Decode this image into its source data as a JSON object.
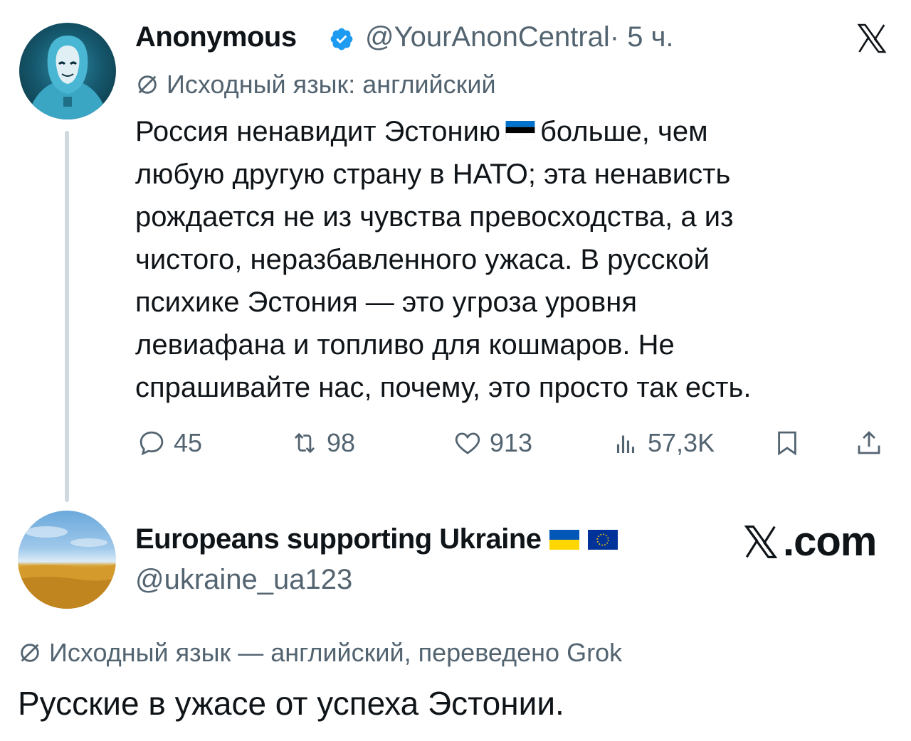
{
  "tweet": {
    "author": {
      "name": "Anonymous",
      "handle": "@YourAnonCentral",
      "time": "· 5 ч.",
      "verified": true,
      "avatar_icon": "anonymous-hooded-figure"
    },
    "translation_note": "Исходный язык: английский",
    "text_lines": [
      "Россия ненавидит Эстонию",
      "больше, чем",
      "любую другую страну в НАТО; эта ненависть",
      "рождается не из чувства превосходства, а из",
      "чистого, неразбавленного ужаса. В русской",
      "психике Эстония — это угроза уровня",
      "левиафана и топливо для кошмаров. Не",
      "спрашивайте нас, почему, это просто так есть."
    ],
    "actions": {
      "replies": "45",
      "reposts": "98",
      "likes": "913",
      "views": "57,3K"
    }
  },
  "reply": {
    "author": {
      "name": "Europeans supporting Ukraine",
      "handle": "@ukraine_ua123",
      "avatar_icon": "wheat-field-sky"
    },
    "translation_note": "Исходный язык — английский, переведено Grok",
    "text": "Русские в ужасе от успеха Эстонии."
  },
  "branding": {
    "watermark": ".com"
  },
  "colors": {
    "text": "#0f1419",
    "muted": "#536471",
    "verified_blue": "#1d9bf0",
    "thread_line": "#cfd9de"
  }
}
